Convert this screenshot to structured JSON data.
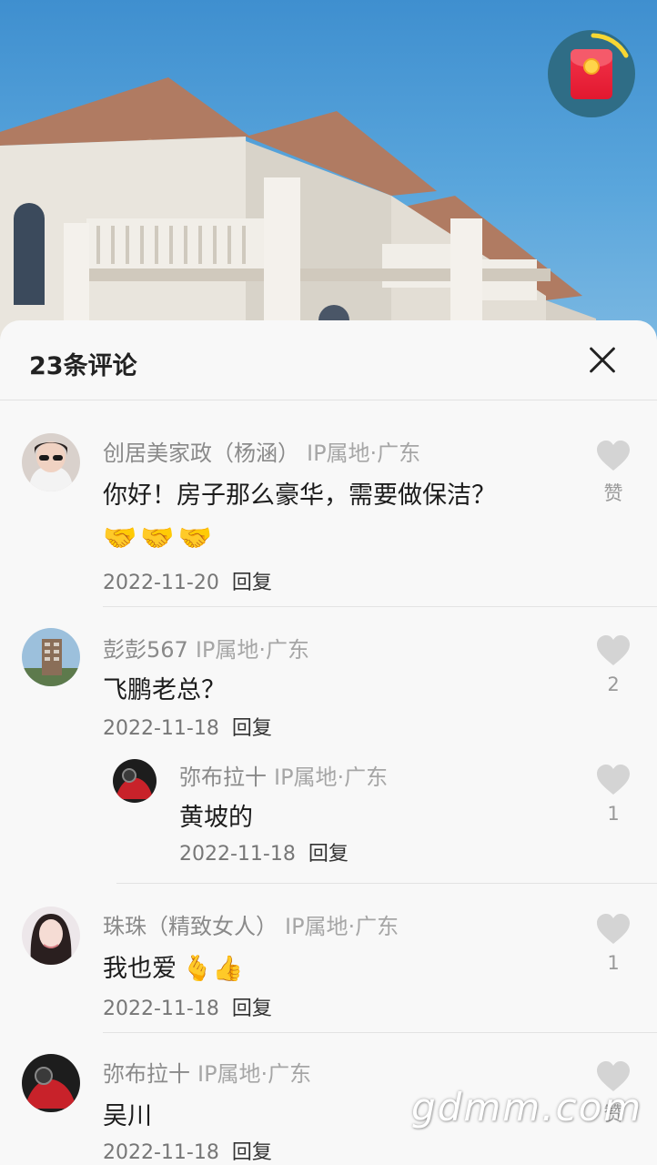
{
  "header": {
    "title": "23条评论"
  },
  "comments": [
    {
      "user": "创居美家政（杨涵）",
      "ip": "IP属地·广东",
      "text": "你好！房子那么豪华，需要做保洁？",
      "emojis": "🤝🤝🤝",
      "date": "2022-11-20",
      "reply": "回复",
      "likes": "赞"
    },
    {
      "user": "彭彭567",
      "ip": "IP属地·广东",
      "text": "飞鹏老总？",
      "date": "2022-11-18",
      "reply": "回复",
      "likes": "2"
    },
    {
      "user": "弥布拉十",
      "ip": "IP属地·广东",
      "text": "黄坡的",
      "date": "2022-11-18",
      "reply": "回复",
      "likes": "1"
    },
    {
      "user": "珠珠（精致女人）",
      "ip": "IP属地·广东",
      "text": "我也爱",
      "emojis": "🫰👍",
      "date": "2022-11-18",
      "reply": "回复",
      "likes": "1"
    },
    {
      "user": "弥布拉十",
      "ip": "IP属地·广东",
      "text": "吴川",
      "date": "2022-11-18",
      "reply": "回复",
      "likes": "赞"
    }
  ],
  "watermark": "gdmm.com",
  "colors": {
    "sky": "#4a9bd6",
    "sheet": "#f8f8f8",
    "redpacket": "#e2182f"
  },
  "icons": {
    "close": "close-icon",
    "like": "heart-icon",
    "redpacket": "red-packet-icon"
  }
}
